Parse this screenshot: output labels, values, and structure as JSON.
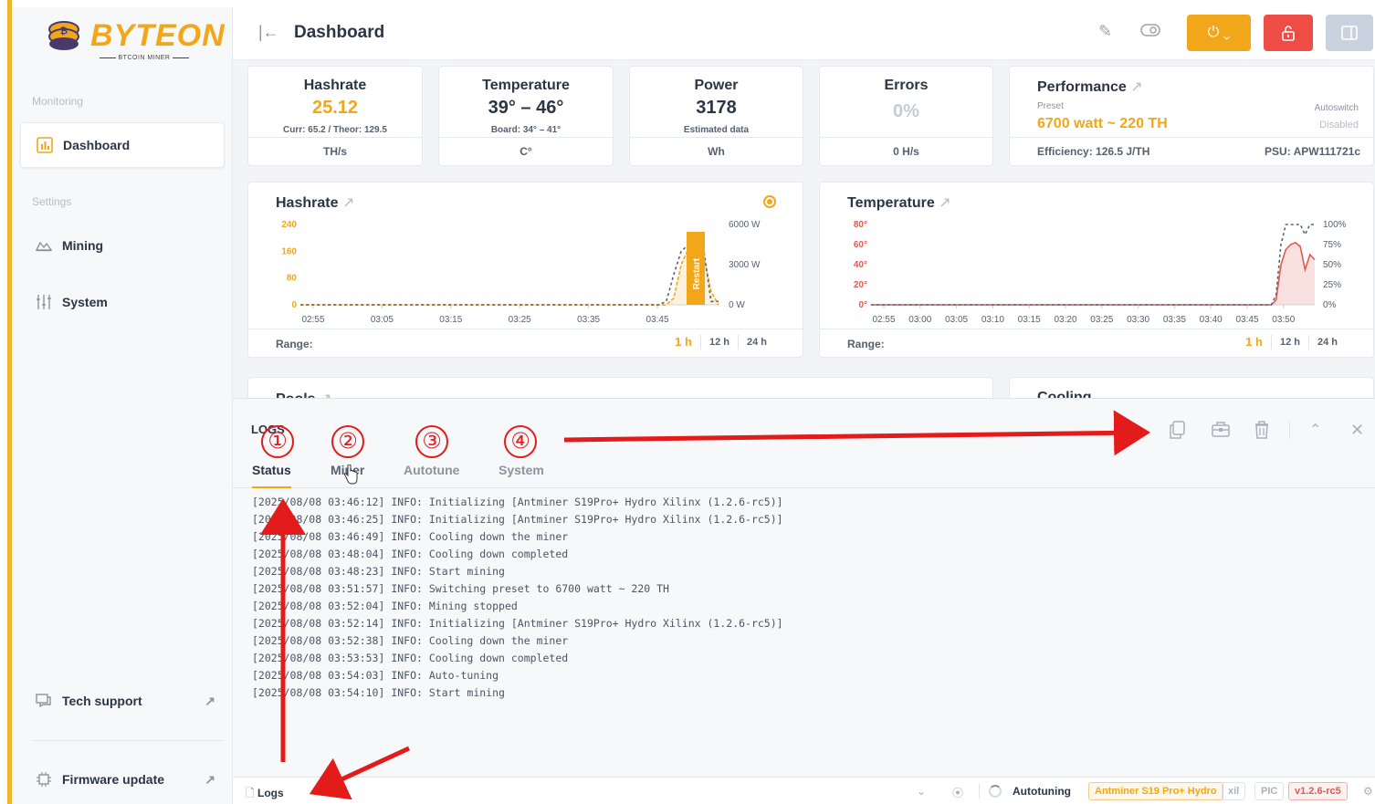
{
  "brand": {
    "name": "BYTEON",
    "tagline": "BTCOIN MINER"
  },
  "sidebar": {
    "sections": {
      "monitoring": "Monitoring",
      "settings": "Settings"
    },
    "items": [
      {
        "label": "Dashboard",
        "icon": "chart-bar-icon",
        "active": true
      },
      {
        "label": "Mining",
        "icon": "mining-icon"
      },
      {
        "label": "System",
        "icon": "sliders-icon"
      },
      {
        "label": "Tech support",
        "icon": "chat-icon"
      },
      {
        "label": "Firmware update",
        "icon": "chip-icon"
      }
    ]
  },
  "header": {
    "title": "Dashboard",
    "power_icon": "⏻ ⌄"
  },
  "stats": {
    "hashrate": {
      "title": "Hashrate",
      "value": "25.12",
      "sub": "Curr: 65.2 / Theor: 129.5",
      "unit": "TH/s"
    },
    "temperature": {
      "title": "Temperature",
      "value": "39° – 46°",
      "sub": "Board: 34° – 41°",
      "unit": "C°"
    },
    "power": {
      "title": "Power",
      "value": "3178",
      "sub": "Estimated data",
      "unit": "Wh"
    },
    "errors": {
      "title": "Errors",
      "value": "0%",
      "unit": "0 H/s"
    },
    "performance": {
      "title": "Performance",
      "preset_label": "Preset",
      "preset_value": "6700 watt ~ 220 TH",
      "autoswitch_label": "Autoswitch",
      "autoswitch_value": "Disabled",
      "efficiency": "Efficiency: 126.5 J/TH",
      "psu": "PSU: APW111721c"
    }
  },
  "charts": {
    "range_label": "Range:",
    "range_options": [
      "1 h",
      "12 h",
      "24 h"
    ],
    "hashrate_title": "Hashrate",
    "temperature_title": "Temperature",
    "restart_label": "Restart"
  },
  "chart_data": [
    {
      "type": "line",
      "title": "Hashrate",
      "x": [
        "02:55",
        "03:05",
        "03:15",
        "03:25",
        "03:35",
        "03:45"
      ],
      "y_ticks": [
        "240",
        "160",
        "80",
        "0"
      ],
      "y2_ticks": [
        "6000 W",
        "3000 W",
        "0 W"
      ],
      "ylim": [
        0,
        240
      ],
      "series": [
        {
          "values": [
            0,
            0,
            0,
            0,
            0,
            0,
            0,
            0,
            0,
            0,
            0,
            0,
            0,
            0,
            0,
            0,
            0,
            0,
            0,
            0,
            0,
            0,
            0,
            0,
            0,
            0,
            0,
            0,
            0,
            0,
            0,
            0,
            0,
            0,
            0,
            0,
            0,
            0,
            0,
            0,
            0,
            0,
            0,
            0,
            0,
            0,
            0,
            0,
            0,
            0,
            20,
            120,
            170,
            175,
            150,
            40,
            0
          ]
        },
        {
          "values": [
            0,
            0,
            0,
            0,
            0,
            0,
            0,
            0,
            0,
            0,
            0,
            0,
            0,
            0,
            0,
            0,
            0,
            0,
            0,
            0,
            0,
            0,
            0,
            0,
            0,
            0,
            0,
            0,
            0,
            0,
            0,
            0,
            0,
            0,
            0,
            0,
            0,
            0,
            0,
            0,
            0,
            0,
            0,
            0,
            0,
            0,
            0,
            0,
            0,
            10,
            90,
            160,
            180,
            180,
            170,
            10,
            10
          ]
        }
      ],
      "annotation": "Restart"
    },
    {
      "type": "line",
      "title": "Temperature",
      "x": [
        "02:55",
        "03:00",
        "03:05",
        "03:10",
        "03:15",
        "03:20",
        "03:25",
        "03:30",
        "03:35",
        "03:40",
        "03:45",
        "03:50"
      ],
      "y_ticks": [
        "80°",
        "60°",
        "40°",
        "20°",
        "0°"
      ],
      "y2_ticks": [
        "100%",
        "75%",
        "50%",
        "25%",
        "0%"
      ],
      "ylim": [
        0,
        80
      ],
      "series": [
        {
          "values": [
            0,
            0,
            0,
            0,
            0,
            0,
            0,
            0,
            0,
            0,
            0,
            0,
            0,
            0,
            0,
            0,
            0,
            0,
            0,
            0,
            0,
            0,
            0,
            0,
            0,
            0,
            0,
            0,
            0,
            0,
            0,
            0,
            0,
            0,
            0,
            0,
            0,
            0,
            0,
            0,
            0,
            0,
            0,
            0,
            0,
            0,
            0,
            0,
            0,
            0,
            0,
            0,
            0,
            0,
            0,
            0,
            0,
            0,
            0,
            0,
            0,
            0,
            0,
            0,
            0,
            0,
            0,
            0,
            0,
            0,
            0,
            0,
            0,
            0,
            0,
            0,
            0,
            0,
            0,
            0,
            0,
            0,
            0,
            0,
            5,
            40,
            55,
            60,
            62,
            58,
            35,
            50,
            45
          ]
        },
        {
          "values": [
            0,
            0,
            0,
            0,
            0,
            0,
            0,
            0,
            0,
            0,
            0,
            0,
            0,
            0,
            0,
            0,
            0,
            0,
            0,
            0,
            0,
            0,
            0,
            0,
            0,
            0,
            0,
            0,
            0,
            0,
            0,
            0,
            0,
            0,
            0,
            0,
            0,
            0,
            0,
            0,
            0,
            0,
            0,
            0,
            0,
            0,
            0,
            0,
            0,
            0,
            0,
            0,
            0,
            0,
            0,
            0,
            0,
            0,
            0,
            0,
            0,
            0,
            0,
            0,
            0,
            0,
            0,
            0,
            0,
            0,
            0,
            0,
            0,
            0,
            0,
            0,
            0,
            0,
            0,
            0,
            0,
            0,
            0,
            0,
            10,
            60,
            80,
            80,
            80,
            80,
            70,
            80,
            80
          ]
        }
      ]
    }
  ],
  "sections": {
    "pools": "Pools",
    "cooling": "Cooling"
  },
  "logs": {
    "title": "LOGS",
    "tabs": [
      "Status",
      "Miner",
      "Autotune",
      "System"
    ],
    "active_tab": "Status",
    "lines": [
      "[2025/08/08 03:46:12] INFO: Initializing [Antminer S19Pro+ Hydro Xilinx (1.2.6-rc5)]",
      "[2025/08/08 03:46:25] INFO: Initializing [Antminer S19Pro+ Hydro Xilinx (1.2.6-rc5)]",
      "[2025/08/08 03:46:49] INFO: Cooling down the miner",
      "[2025/08/08 03:48:04] INFO: Cooling down completed",
      "[2025/08/08 03:48:23] INFO: Start mining",
      "[2025/08/08 03:51:57] INFO: Switching preset to 6700 watt ~ 220 TH",
      "[2025/08/08 03:52:04] INFO: Mining stopped",
      "[2025/08/08 03:52:14] INFO: Initializing [Antminer S19Pro+ Hydro Xilinx (1.2.6-rc5)]",
      "[2025/08/08 03:52:38] INFO: Cooling down the miner",
      "[2025/08/08 03:53:53] INFO: Cooling down completed",
      "[2025/08/08 03:54:03] INFO: Auto-tuning",
      "[2025/08/08 03:54:10] INFO: Start mining"
    ],
    "annotations": [
      "①",
      "②",
      "③",
      "④"
    ]
  },
  "statusbar": {
    "logs_label": "Logs",
    "autotuning": "Autotuning",
    "model": "Antminer S19 Pro+ Hydro",
    "badge_xil": "xil",
    "badge_pic": "PIC",
    "version": "v1.2.6-rc5"
  },
  "colors": {
    "accent": "#f2a619",
    "danger": "#ee4d45",
    "annotation": "#e41b1b",
    "chart_line": "#f2a619",
    "temp_line": "#e05a4f"
  }
}
